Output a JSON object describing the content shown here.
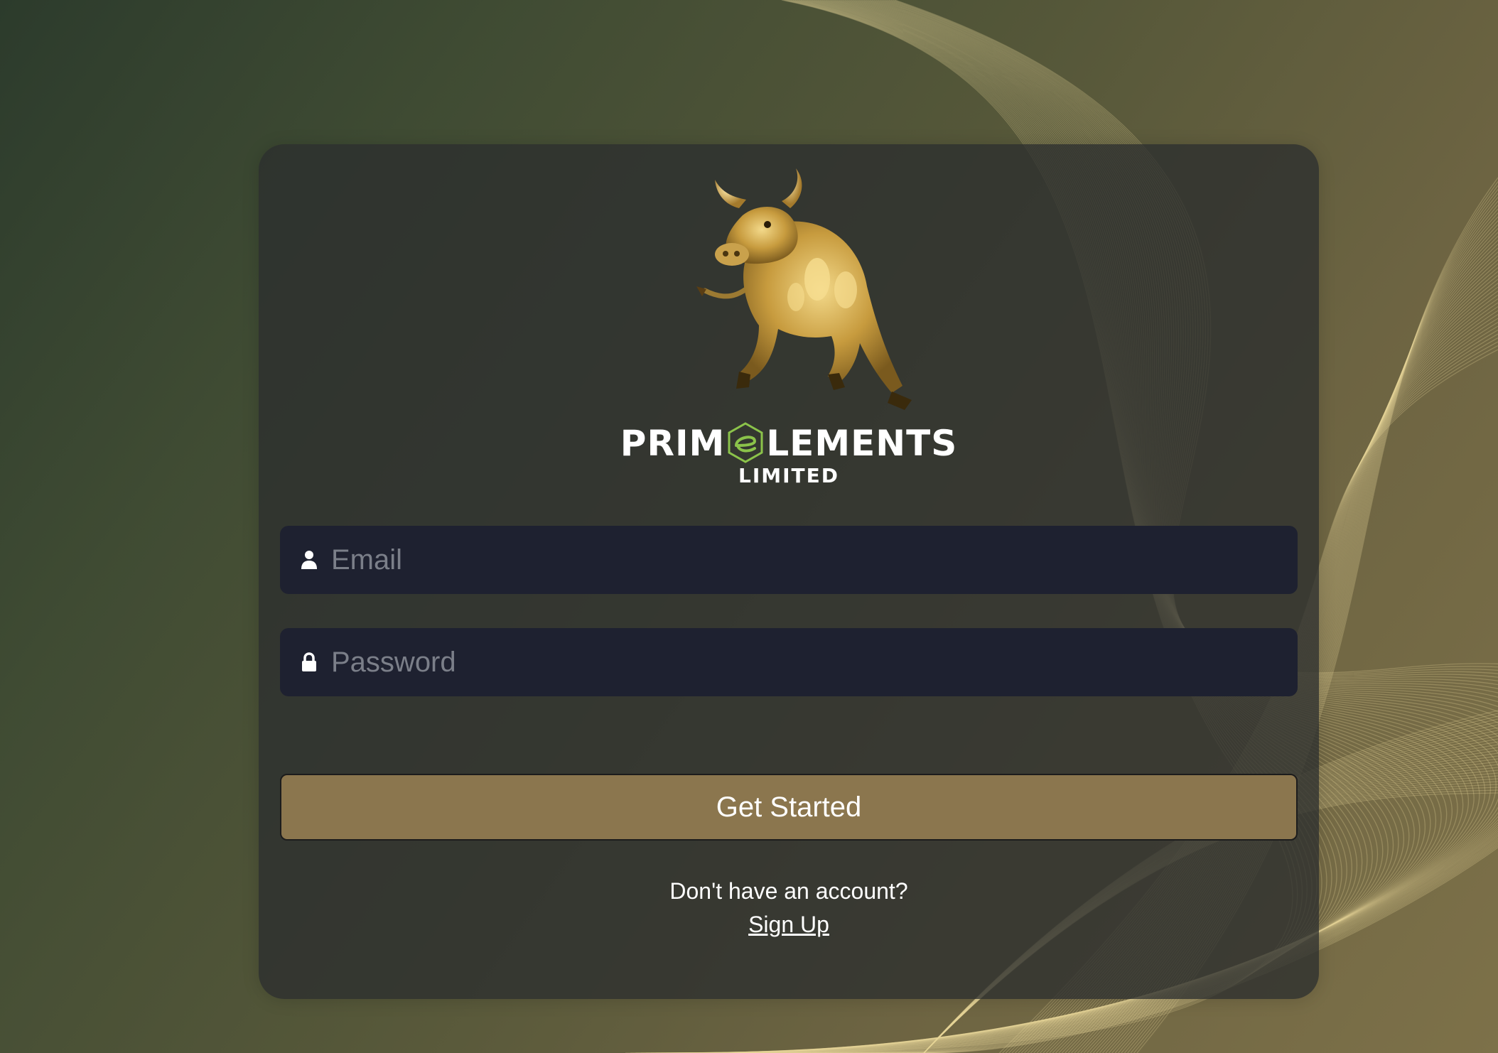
{
  "brand": {
    "name_left": "PRIM",
    "name_right": "LEMENTS",
    "subtitle": "LIMITED",
    "logo_icon": "bull-icon",
    "mark_icon": "e-mark-icon",
    "mark_color": "#8bc34a"
  },
  "login": {
    "email_placeholder": "Email",
    "email_icon": "user-icon",
    "password_placeholder": "Password",
    "password_icon": "lock-icon",
    "submit_label": "Get Started",
    "signup_prompt": "Don't have an account?",
    "signup_link": "Sign Up"
  },
  "colors": {
    "card": "#2c2e2e",
    "input": "#1e2130",
    "button": "#8b764e",
    "accent_gold": "#c9a94a"
  }
}
